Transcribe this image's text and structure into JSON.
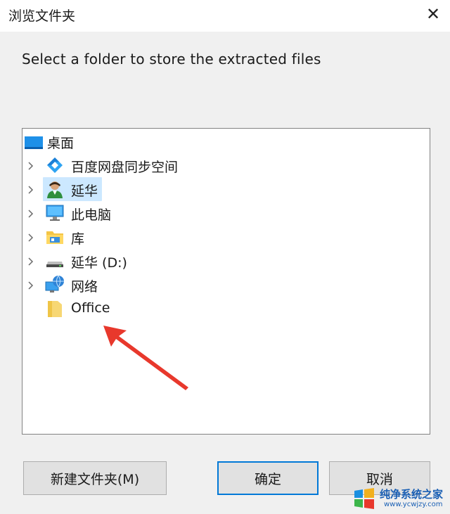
{
  "window": {
    "title": "浏览文件夹",
    "close_glyph": "✕"
  },
  "instruction": "Select a folder to store the extracted files",
  "tree": {
    "items": [
      {
        "label": "桌面",
        "icon": "desktop-icon"
      },
      {
        "label": "百度网盘同步空间",
        "icon": "baidu-netdisk-icon"
      },
      {
        "label": "延华",
        "icon": "user-icon",
        "selected": true
      },
      {
        "label": "此电脑",
        "icon": "computer-icon"
      },
      {
        "label": "库",
        "icon": "library-folder-icon"
      },
      {
        "label": "延华 (D:)",
        "icon": "drive-icon"
      },
      {
        "label": "网络",
        "icon": "network-icon"
      },
      {
        "label": "Office",
        "icon": "folder-icon"
      }
    ]
  },
  "buttons": {
    "new_folder": "新建文件夹(M)",
    "ok": "确定",
    "cancel": "取消"
  },
  "watermark": {
    "text": "纯净系统之家",
    "url": "www.ycwjzy.com"
  },
  "colors": {
    "accent": "#0078d7",
    "selection": "#cce8ff",
    "arrow": "#e8382c"
  }
}
